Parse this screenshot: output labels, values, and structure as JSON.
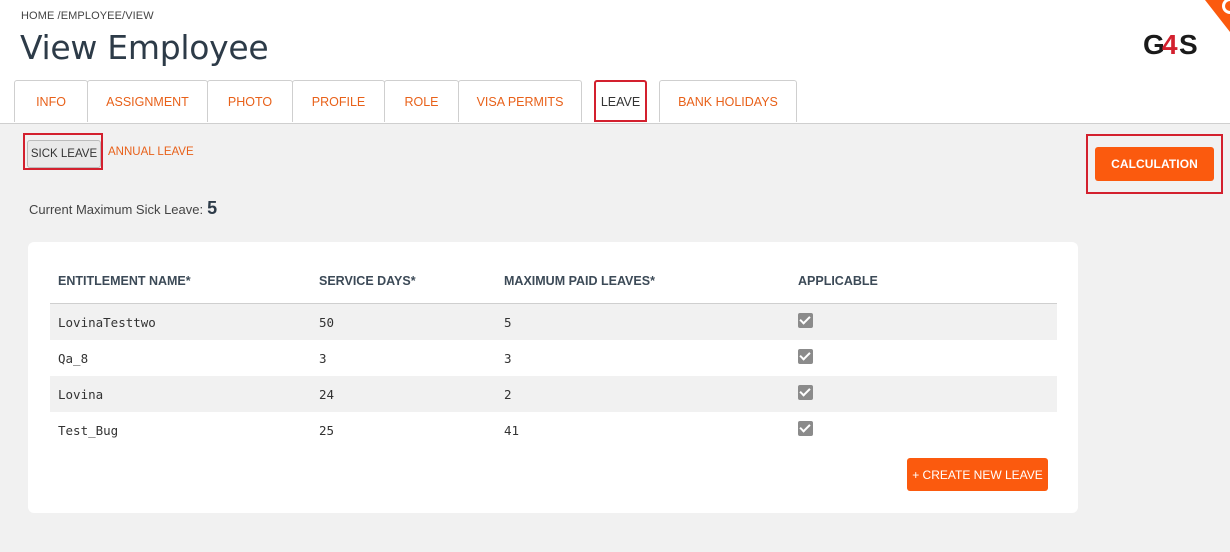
{
  "breadcrumb": "HOME /EMPLOYEE/VIEW",
  "title": "View Employee",
  "tabs": [
    {
      "label": "INFO"
    },
    {
      "label": "ASSIGNMENT"
    },
    {
      "label": "PHOTO"
    },
    {
      "label": "PROFILE"
    },
    {
      "label": "ROLE"
    },
    {
      "label": "VISA PERMITS"
    },
    {
      "label": "LEAVE"
    },
    {
      "label": "BANK HOLIDAYS"
    }
  ],
  "active_tab": "LEAVE",
  "subtabs": {
    "sick": "SICK LEAVE",
    "annual": "ANNUAL LEAVE"
  },
  "calculation_label": "CALCULATION",
  "max_leave": {
    "label": "Current Maximum Sick Leave:",
    "value": "5"
  },
  "table": {
    "headers": [
      "ENTITLEMENT NAME*",
      "SERVICE DAYS*",
      "MAXIMUM PAID LEAVES*",
      "APPLICABLE"
    ],
    "rows": [
      {
        "name": "LovinaTesttwo",
        "service_days": "50",
        "max_paid": "5",
        "applicable": true
      },
      {
        "name": "Qa_8",
        "service_days": "3",
        "max_paid": "3",
        "applicable": true
      },
      {
        "name": "Lovina",
        "service_days": "24",
        "max_paid": "2",
        "applicable": true
      },
      {
        "name": "Test_Bug",
        "service_days": "25",
        "max_paid": "41",
        "applicable": true
      }
    ]
  },
  "create_label": "+ CREATE NEW LEAVE",
  "logo_text": "G4S",
  "colors": {
    "accent": "#fb5a0e",
    "link": "#e8611a",
    "highlight": "#d3202e",
    "title": "#2d3b48"
  },
  "icons": {
    "checkbox": "checkbox-checked-icon"
  }
}
